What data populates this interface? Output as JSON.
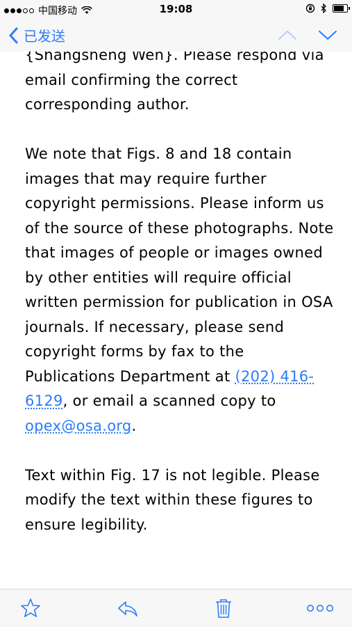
{
  "status_bar": {
    "carrier": "中国移动",
    "time": "19:08"
  },
  "nav": {
    "back_label": "已发送",
    "icons": [
      "chevron-left-icon",
      "chevron-up-icon",
      "chevron-down-icon"
    ]
  },
  "email": {
    "partial_first_line": "{Shangsheng Wen}. Please respond",
    "p1_rest": "via email confirming the correct corresponding author.",
    "p2_before_phone": "We note that Figs. 8 and 18 contain images that may require further copyright permissions. Please inform us of the source of these photographs. Note that images of people or images owned by other entities will require official written permission for publication in OSA journals. If necessary, please send copyright forms by fax to the Publications Department at ",
    "phone": "(202) 416-6129",
    "p2_after_phone": ", or email a scanned copy to ",
    "email_link": "opex@osa.org",
    "p2_end": ".",
    "p3": "Text within Fig. 17 is not legible. Please modify the text within these figures to ensure legibility."
  },
  "toolbar": {
    "icons": [
      "star-icon",
      "reply-icon",
      "trash-icon",
      "more-icon"
    ]
  },
  "colors": {
    "accent": "#2a7cf6",
    "bar_bg": "#f7f7f7"
  }
}
